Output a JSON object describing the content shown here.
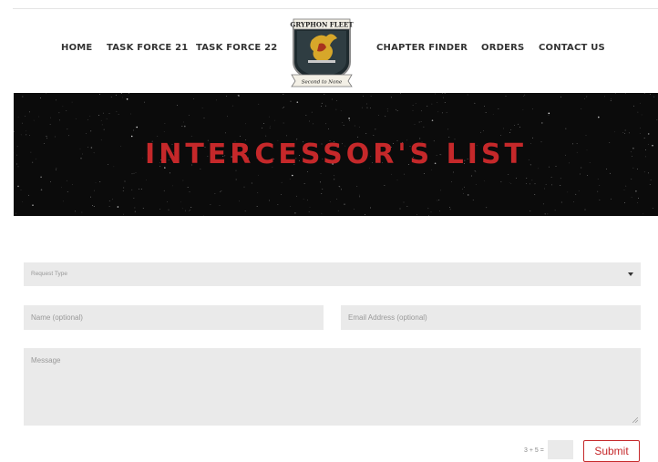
{
  "nav": {
    "home": "HOME",
    "task_force_21": "TASK FORCE 21",
    "task_force_22": "TASK FORCE 22",
    "chapter_finder": "CHAPTER FINDER",
    "orders": "ORDERS",
    "contact_us": "CONTACT US"
  },
  "logo": {
    "banner_text": "GRYPHON FLEET",
    "motto": "Second to None",
    "icon": "gryphon-emblem-icon"
  },
  "hero": {
    "title": "INTERCESSOR'S LIST"
  },
  "form": {
    "request_type_placeholder": "Request Type",
    "name_placeholder": "Name (optional)",
    "email_placeholder": "Email Address (optional)",
    "message_placeholder": "Message",
    "captcha_question": "3 + 5 =",
    "submit_label": "Submit"
  },
  "colors": {
    "accent": "#c5282a",
    "field_bg": "#eaeaea",
    "hero_bg": "#0b0b0b",
    "nav_text": "#333333"
  }
}
